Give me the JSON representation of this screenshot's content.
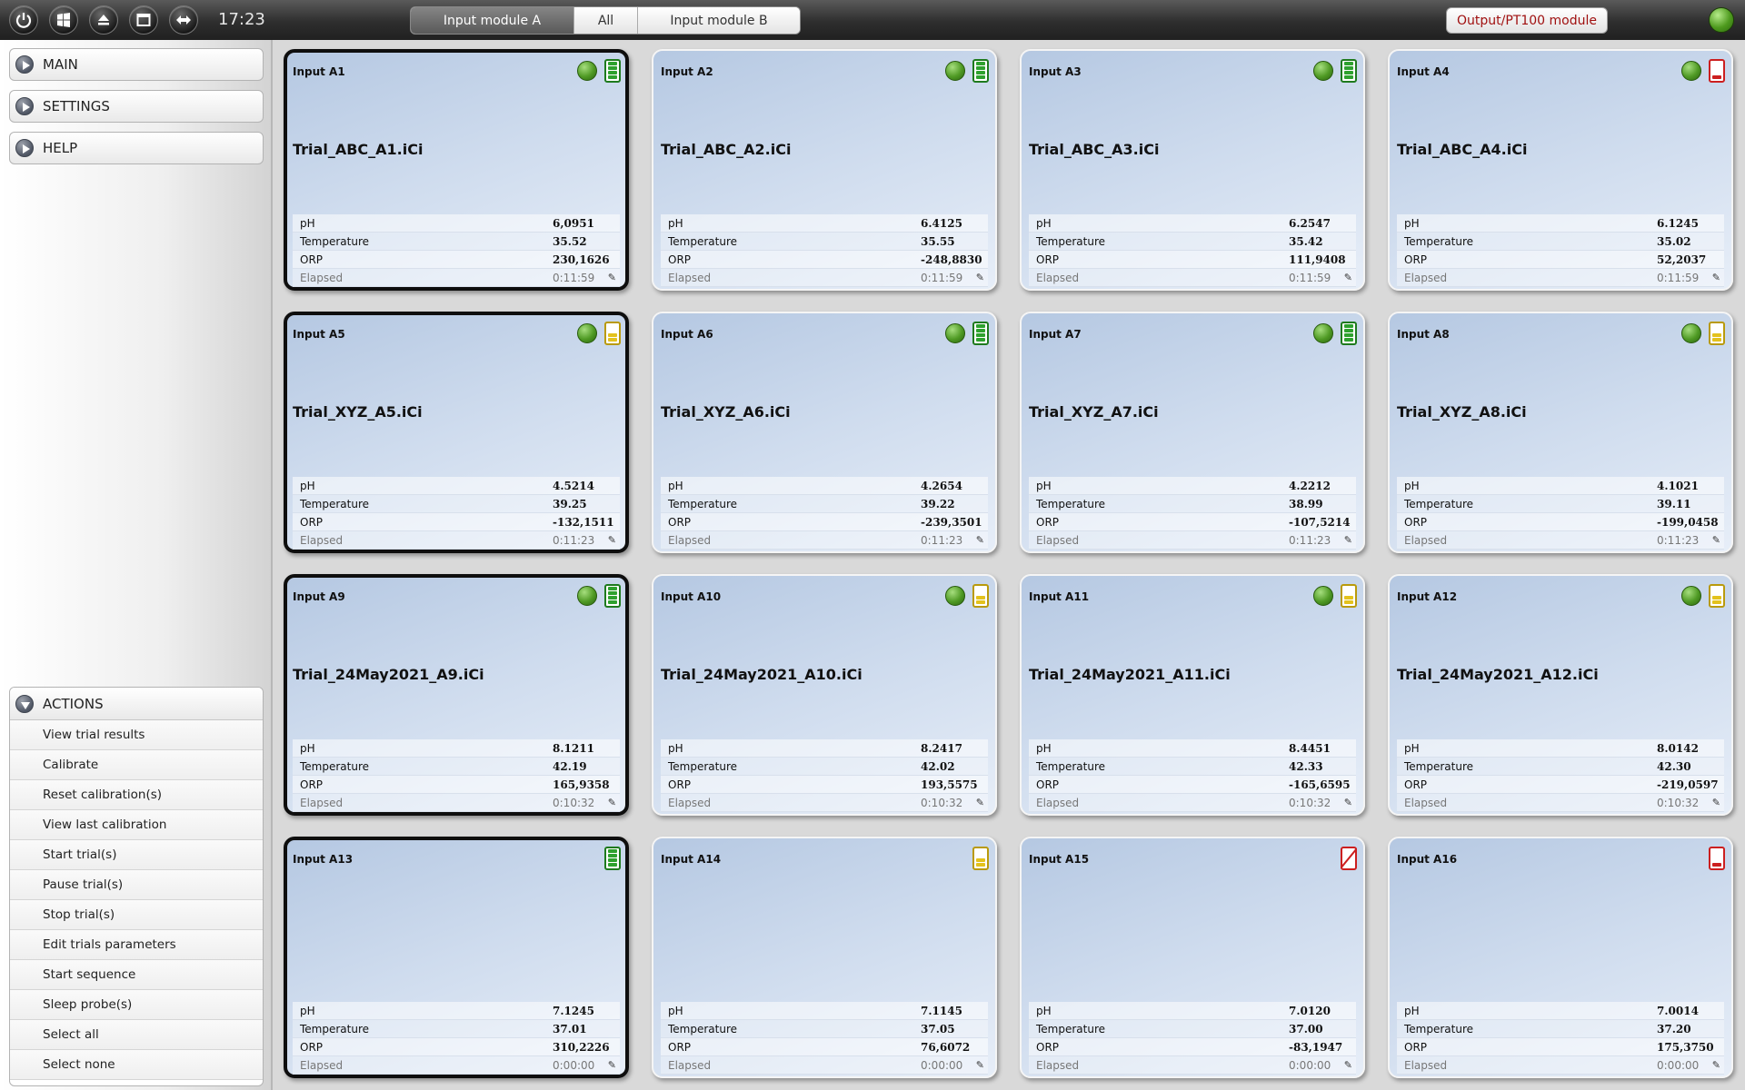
{
  "topbar": {
    "time": "17:23",
    "tabs": [
      {
        "label": "Input module A",
        "active": true
      },
      {
        "label": "All",
        "active": false
      },
      {
        "label": "Input module B",
        "active": false
      }
    ],
    "output_button": "Output/PT100 module",
    "icons": [
      "power-icon",
      "windows-icon",
      "eject-icon",
      "window-icon",
      "swap-icon"
    ]
  },
  "sidebar": {
    "menu": [
      {
        "label": "MAIN"
      },
      {
        "label": "SETTINGS"
      },
      {
        "label": "HELP"
      }
    ],
    "actions_title": "ACTIONS",
    "actions": [
      "View trial results",
      "Calibrate",
      "Reset calibration(s)",
      "View last calibration",
      "Start trial(s)",
      "Pause trial(s)",
      "Stop trial(s)",
      "Edit trials parameters",
      "Start sequence",
      "Sleep probe(s)",
      "Select all",
      "Select none"
    ]
  },
  "row_labels": {
    "ph": "pH",
    "temperature": "Temperature",
    "orp": "ORP",
    "elapsed": "Elapsed"
  },
  "colors": {
    "battery_full": "#2ea12e",
    "battery_half": "#e3c21d",
    "battery_low": "#cc1f1f",
    "selected_border": "#0e0e0e",
    "output_text": "#a01010"
  },
  "cards": [
    {
      "title": "Input A1",
      "file": "Trial_ABC_A1.iCi",
      "ph": "6,0951",
      "temp": "35.52",
      "orp": "230,1626",
      "elapsed": "0:11:59",
      "led": true,
      "battery": "full",
      "selected": true
    },
    {
      "title": "Input A2",
      "file": "Trial_ABC_A2.iCi",
      "ph": "6.4125",
      "temp": "35.55",
      "orp": "-248,8830",
      "elapsed": "0:11:59",
      "led": true,
      "battery": "full",
      "selected": false
    },
    {
      "title": "Input A3",
      "file": "Trial_ABC_A3.iCi",
      "ph": "6.2547",
      "temp": "35.42",
      "orp": "111,9408",
      "elapsed": "0:11:59",
      "led": true,
      "battery": "full",
      "selected": false
    },
    {
      "title": "Input A4",
      "file": "Trial_ABC_A4.iCi",
      "ph": "6.1245",
      "temp": "35.02",
      "orp": "52,2037",
      "elapsed": "0:11:59",
      "led": true,
      "battery": "low",
      "selected": false
    },
    {
      "title": "Input A5",
      "file": "Trial_XYZ_A5.iCi",
      "ph": "4.5214",
      "temp": "39.25",
      "orp": "-132,1511",
      "elapsed": "0:11:23",
      "led": true,
      "battery": "half",
      "selected": true
    },
    {
      "title": "Input A6",
      "file": "Trial_XYZ_A6.iCi",
      "ph": "4.2654",
      "temp": "39.22",
      "orp": "-239,3501",
      "elapsed": "0:11:23",
      "led": true,
      "battery": "full",
      "selected": false
    },
    {
      "title": "Input A7",
      "file": "Trial_XYZ_A7.iCi",
      "ph": "4.2212",
      "temp": "38.99",
      "orp": "-107,5214",
      "elapsed": "0:11:23",
      "led": true,
      "battery": "full",
      "selected": false
    },
    {
      "title": "Input A8",
      "file": "Trial_XYZ_A8.iCi",
      "ph": "4.1021",
      "temp": "39.11",
      "orp": "-199,0458",
      "elapsed": "0:11:23",
      "led": true,
      "battery": "half",
      "selected": false
    },
    {
      "title": "Input A9",
      "file": "Trial_24May2021_A9.iCi",
      "ph": "8.1211",
      "temp": "42.19",
      "orp": "165,9358",
      "elapsed": "0:10:32",
      "led": true,
      "battery": "full",
      "selected": true
    },
    {
      "title": "Input A10",
      "file": "Trial_24May2021_A10.iCi",
      "ph": "8.2417",
      "temp": "42.02",
      "orp": "193,5575",
      "elapsed": "0:10:32",
      "led": true,
      "battery": "half",
      "selected": false
    },
    {
      "title": "Input A11",
      "file": "Trial_24May2021_A11.iCi",
      "ph": "8.4451",
      "temp": "42.33",
      "orp": "-165,6595",
      "elapsed": "0:10:32",
      "led": true,
      "battery": "half",
      "selected": false
    },
    {
      "title": "Input A12",
      "file": "Trial_24May2021_A12.iCi",
      "ph": "8.0142",
      "temp": "42.30",
      "orp": "-219,0597",
      "elapsed": "0:10:32",
      "led": true,
      "battery": "half",
      "selected": false
    },
    {
      "title": "Input A13",
      "file": "",
      "ph": "7.1245",
      "temp": "37.01",
      "orp": "310,2226",
      "elapsed": "0:00:00",
      "led": false,
      "battery": "full",
      "selected": true
    },
    {
      "title": "Input A14",
      "file": "",
      "ph": "7.1145",
      "temp": "37.05",
      "orp": "76,6072",
      "elapsed": "0:00:00",
      "led": false,
      "battery": "half",
      "selected": false
    },
    {
      "title": "Input A15",
      "file": "",
      "ph": "7.0120",
      "temp": "37.00",
      "orp": "-83,1947",
      "elapsed": "0:00:00",
      "led": false,
      "battery": "empty",
      "selected": false
    },
    {
      "title": "Input A16",
      "file": "",
      "ph": "7.0014",
      "temp": "37.20",
      "orp": "175,3750",
      "elapsed": "0:00:00",
      "led": false,
      "battery": "low",
      "selected": false
    }
  ]
}
